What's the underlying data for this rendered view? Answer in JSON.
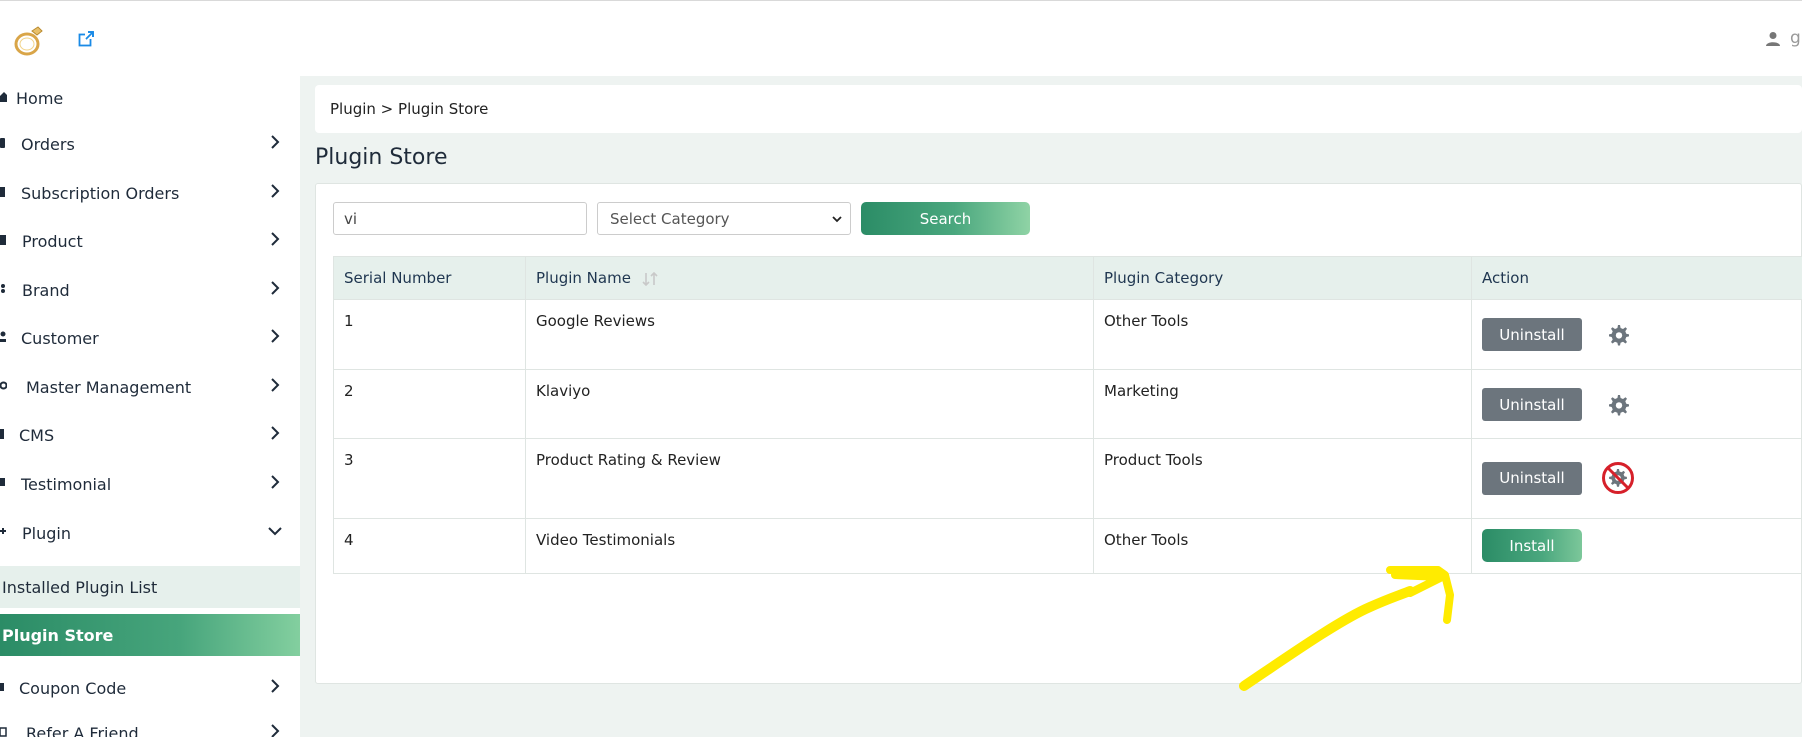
{
  "header": {
    "logo_icon": "ring-logo-icon",
    "external_link_icon": "external-link-icon",
    "user_icon": "user-icon",
    "user_name_partial": "g"
  },
  "sidebar": {
    "items": [
      {
        "label": "Home",
        "icon": "home-icon",
        "has_chevron": false
      },
      {
        "label": "Orders",
        "icon": "orders-icon",
        "has_chevron": true
      },
      {
        "label": "Subscription Orders",
        "icon": "subscription-icon",
        "has_chevron": true
      },
      {
        "label": "Product",
        "icon": "product-icon",
        "has_chevron": true
      },
      {
        "label": "Brand",
        "icon": "brand-icon",
        "has_chevron": true
      },
      {
        "label": "Customer",
        "icon": "customer-icon",
        "has_chevron": true
      },
      {
        "label": "Master Management",
        "icon": "gear-icon",
        "has_chevron": true
      },
      {
        "label": "CMS",
        "icon": "cms-icon",
        "has_chevron": true
      },
      {
        "label": "Testimonial",
        "icon": "testimonial-icon",
        "has_chevron": true
      },
      {
        "label": "Plugin",
        "icon": "plugin-icon",
        "has_chevron": true,
        "expanded": true
      },
      {
        "label": "Coupon Code",
        "icon": "coupon-icon",
        "has_chevron": true
      },
      {
        "label": "Refer A Friend",
        "icon": "refer-icon",
        "has_chevron": true
      }
    ],
    "plugin_subitems": [
      {
        "label": "Installed Plugin List",
        "active": false
      },
      {
        "label": "Plugin Store",
        "active": true
      }
    ]
  },
  "breadcrumb": "Plugin > Plugin Store",
  "page_title": "Plugin Store",
  "filters": {
    "search_value": "vi",
    "category_placeholder": "Select Category",
    "search_button": "Search"
  },
  "table": {
    "headers": [
      "Serial Number",
      "Plugin Name",
      "Plugin Category",
      "Action"
    ],
    "rows": [
      {
        "serial": "1",
        "name": "Google Reviews",
        "category": "Other Tools",
        "action": "Uninstall",
        "action_icon": "settings-icon"
      },
      {
        "serial": "2",
        "name": "Klaviyo",
        "category": "Marketing",
        "action": "Uninstall",
        "action_icon": "settings-icon"
      },
      {
        "serial": "3",
        "name": "Product Rating & Review",
        "category": "Product Tools",
        "action": "Uninstall",
        "action_icon": "settings-disabled-icon"
      },
      {
        "serial": "4",
        "name": "Video Testimonials",
        "category": "Other Tools",
        "action": "Install",
        "action_icon": ""
      }
    ]
  },
  "colors": {
    "accent_start": "#2b8c66",
    "accent_end": "#8fd3a5",
    "uninstall_gray": "#6c757d",
    "annotation_yellow": "#ffeb00",
    "disabled_red": "#d6202a"
  }
}
